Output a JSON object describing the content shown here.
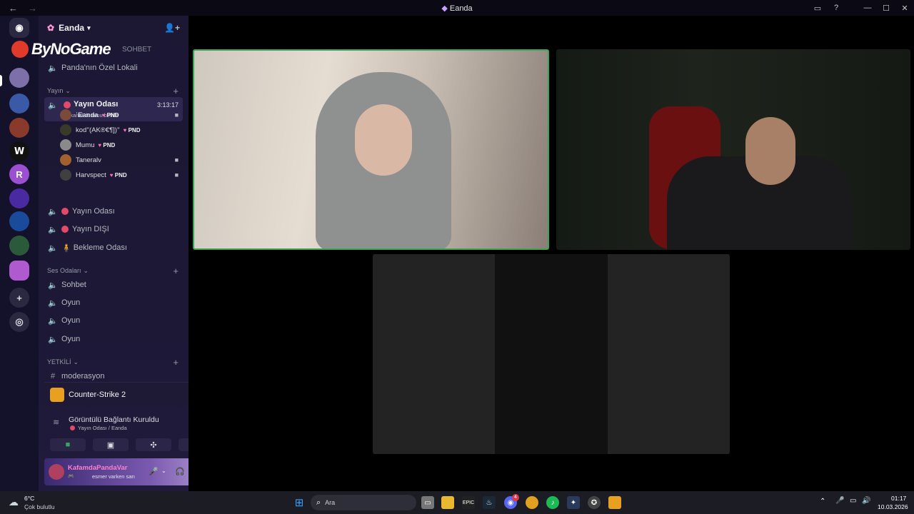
{
  "window": {
    "title": "Eanda",
    "back": "←",
    "forward": "→"
  },
  "overlay_logo": "ByNoGame",
  "server": {
    "name": "Eanda",
    "first_channel_partial": "SOHBET",
    "lokal": "Panda'nın Özel Lokali"
  },
  "categories": {
    "yayin": "Yayın",
    "ses": "Ses Odaları",
    "yetkili": "YETKİLİ"
  },
  "active_channel": {
    "name": "Yayın Odası",
    "timer": "3:13:17",
    "status_hint": "Bir kanal durumu belirle"
  },
  "members": [
    {
      "name": "ˈEanda",
      "badge": "PND",
      "camera": true,
      "color": "#7a4a3a"
    },
    {
      "name": "kod''(AK®€¶])''",
      "badge": "PND",
      "camera": false,
      "color": "#3a3a2a"
    },
    {
      "name": "Mumu",
      "badge": "PND",
      "camera": false,
      "color": "#8a8a8a"
    },
    {
      "name": "Taneralv",
      "badge": "",
      "camera": true,
      "color": "#a06030"
    },
    {
      "name": "Harvspect",
      "badge": "PND",
      "camera": true,
      "color": "#404040"
    }
  ],
  "voice_channels": [
    {
      "name": "Yayın Odası",
      "dot": true
    },
    {
      "name": "Yayın DIŞI",
      "dot": true
    },
    {
      "name": "Bekleme Odası",
      "dot": false,
      "prefix": "🧍"
    }
  ],
  "ses_channels": [
    "Sohbet",
    "Oyun",
    "Oyun",
    "Oyun"
  ],
  "text_channels": [
    "moderasyon"
  ],
  "activity": {
    "game": "Counter-Strike 2"
  },
  "connection": {
    "status": "Görüntülü Bağlantı Kuruldu",
    "location": "Yayın Odası / Eanda"
  },
  "user": {
    "name": "KafamdaPandaVar",
    "custom_status": "esmer varken sarı"
  },
  "taskbar": {
    "weather_temp": "6°C",
    "weather_desc": "Çok bulutlu",
    "search_placeholder": "Ara",
    "time": "01:17",
    "date": "10.03.2026",
    "discord_badge": "4"
  },
  "colors": {
    "accent_green": "#3ba55d",
    "live_red": "#e24a6a",
    "pink": "#ff6fb5"
  }
}
